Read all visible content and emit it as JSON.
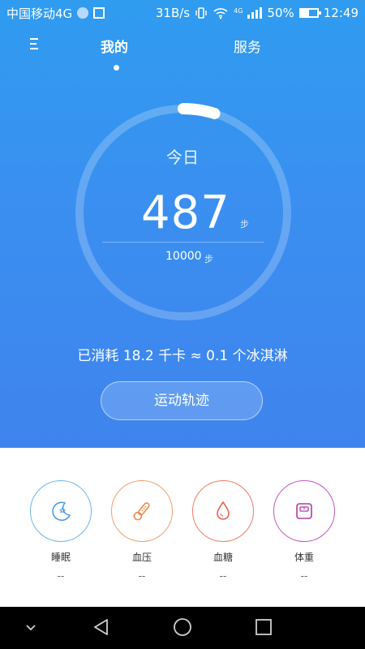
{
  "status_bar": {
    "carrier": "中国移动4G",
    "net_speed": "31B/s",
    "net_type": "4G",
    "battery": "50%",
    "battery_level": 0.5,
    "time": "12:49"
  },
  "tabs": [
    {
      "label": "我的",
      "active": true
    },
    {
      "label": "服务",
      "active": false
    }
  ],
  "steps": {
    "today_label": "今日",
    "count": "487",
    "unit": "步",
    "goal": "10000",
    "goal_unit": "步",
    "progress": 0.0487
  },
  "calorie_text": "已消耗 18.2 千卡 ≈ 0.1 个冰淇淋",
  "track_button": "运动轨迹",
  "metrics": [
    {
      "label": "睡眠",
      "value": "--",
      "icon": "moon-icon",
      "color": "#4a9be6"
    },
    {
      "label": "血压",
      "value": "--",
      "icon": "thermometer-icon",
      "color": "#ee8a4e"
    },
    {
      "label": "血糖",
      "value": "--",
      "icon": "blood-drop-icon",
      "color": "#e9634a"
    },
    {
      "label": "体重",
      "value": "--",
      "icon": "scale-icon",
      "color": "#b23aa8"
    }
  ],
  "nav_icons": [
    "chevron-down-icon",
    "back-icon",
    "home-icon",
    "recent-apps-icon"
  ]
}
